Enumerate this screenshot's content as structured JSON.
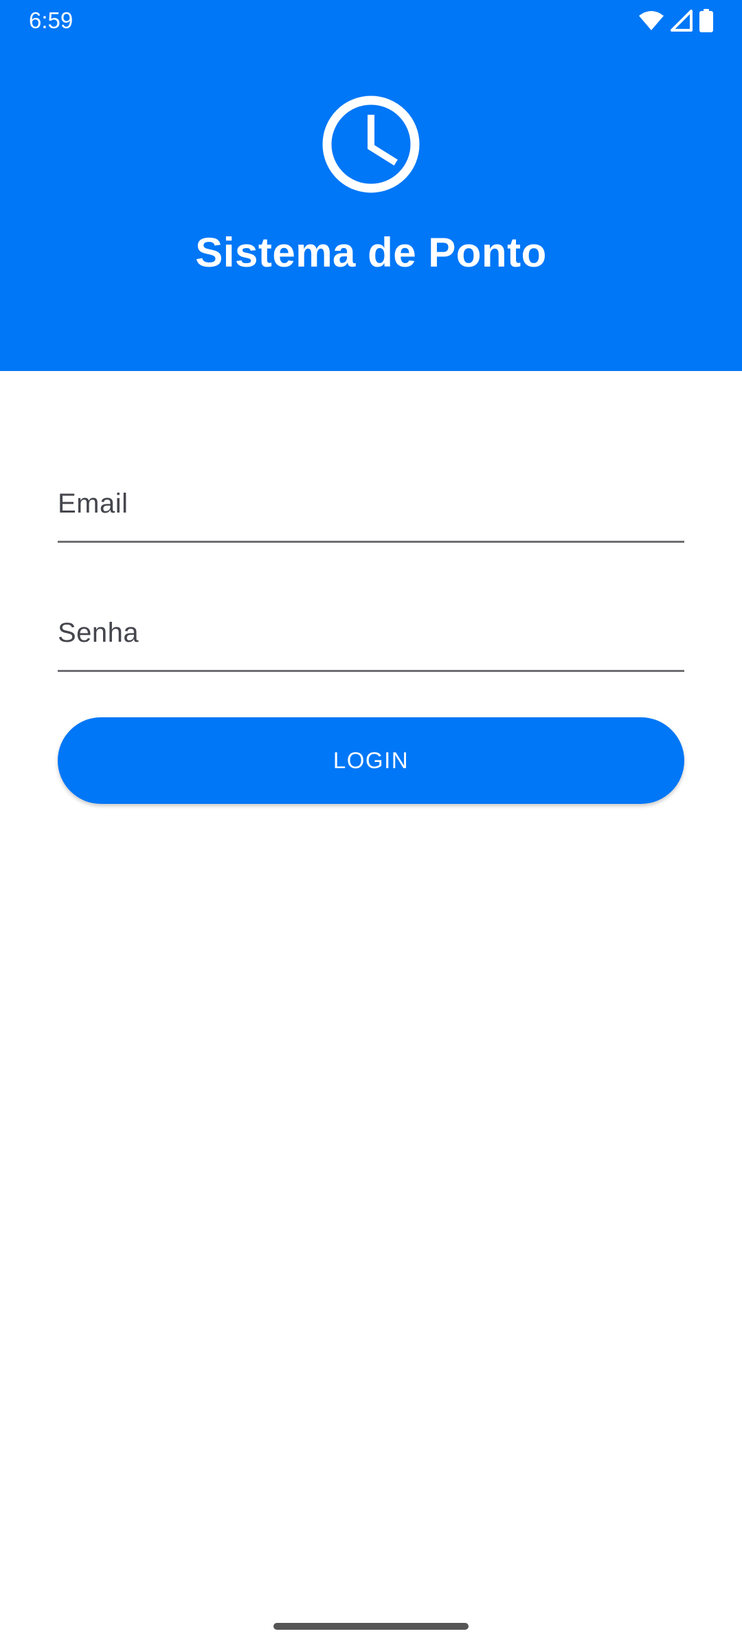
{
  "status_bar": {
    "time": "6:59",
    "icons": [
      "wifi-icon",
      "cell-signal-icon",
      "battery-icon"
    ]
  },
  "header": {
    "icon": "clock-icon",
    "title": "Sistema de Ponto",
    "background_color": "#0077f7"
  },
  "form": {
    "email": {
      "placeholder": "Email",
      "value": ""
    },
    "password": {
      "placeholder": "Senha",
      "value": ""
    },
    "login_label": "LOGIN",
    "button_color": "#0077f7"
  }
}
